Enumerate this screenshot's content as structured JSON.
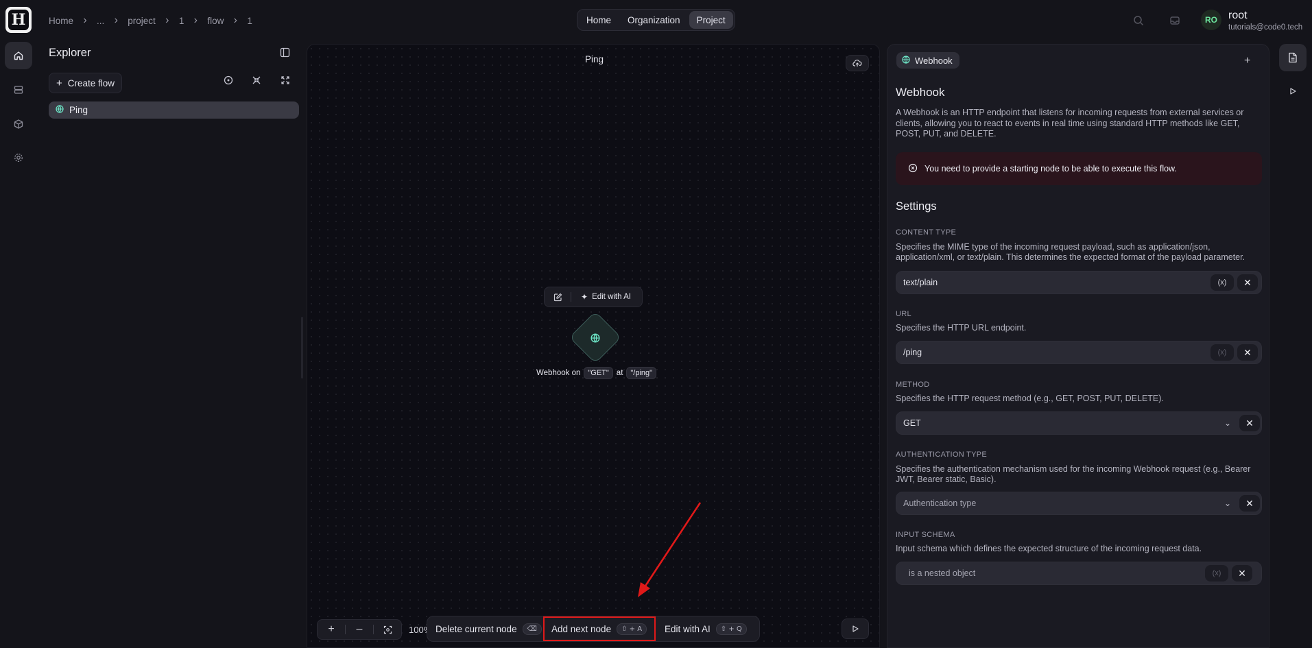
{
  "breadcrumbs": [
    "Home",
    "...",
    "project",
    "1",
    "flow",
    "1"
  ],
  "nav": {
    "home": "Home",
    "organization": "Organization",
    "project": "Project",
    "active": "Project"
  },
  "user": {
    "initials": "RO",
    "name": "root",
    "email": "tutorials@code0.tech"
  },
  "explorer": {
    "title": "Explorer",
    "create_flow": "Create flow",
    "items": [
      {
        "label": "Ping",
        "icon": "globe-icon"
      }
    ]
  },
  "canvas": {
    "title": "Ping",
    "node_toolbar": {
      "edit_ai": "Edit with AI"
    },
    "node": {
      "prefix": "Webhook on",
      "method": "\"GET\"",
      "at": "at",
      "path": "\"/ping\""
    },
    "zoom": "100%",
    "actions": {
      "delete": "Delete current node",
      "delete_kbd": "⌫",
      "add": "Add next node",
      "add_kbd": "⇧ + A",
      "edit_ai": "Edit with AI",
      "edit_ai_kbd": "⇧ + Q"
    }
  },
  "panel": {
    "chip": "Webhook",
    "title": "Webhook",
    "description": "A Webhook is an HTTP endpoint that listens for incoming requests from external services or clients, allowing you to react to events in real time using standard HTTP methods like GET, POST, PUT, and DELETE.",
    "alert": "You need to provide a starting node to be able to execute this flow.",
    "settings_title": "Settings",
    "fields": {
      "content_type": {
        "label": "CONTENT TYPE",
        "description": "Specifies the MIME type of the incoming request payload, such as application/json, application/xml, or text/plain. This determines the expected format of the payload parameter.",
        "value": "text/plain"
      },
      "url": {
        "label": "URL",
        "description": "Specifies the HTTP URL endpoint.",
        "value": "/ping"
      },
      "method": {
        "label": "METHOD",
        "description": "Specifies the HTTP request method (e.g., GET, POST, PUT, DELETE).",
        "value": "GET"
      },
      "auth_type": {
        "label": "AUTHENTICATION TYPE",
        "description": "Specifies the authentication mechanism used for the incoming Webhook request (e.g., Bearer JWT, Bearer static, Basic).",
        "placeholder": "Authentication type"
      },
      "input_schema": {
        "label": "INPUT SCHEMA",
        "description": "Input schema which defines the expected structure of the incoming request data.",
        "value": "is a nested object"
      }
    },
    "variable_symbol": "(x)"
  },
  "colors": {
    "accent_green": "#6ee7a0",
    "alert_bg": "#2a141c",
    "highlight_red": "#e01919"
  }
}
